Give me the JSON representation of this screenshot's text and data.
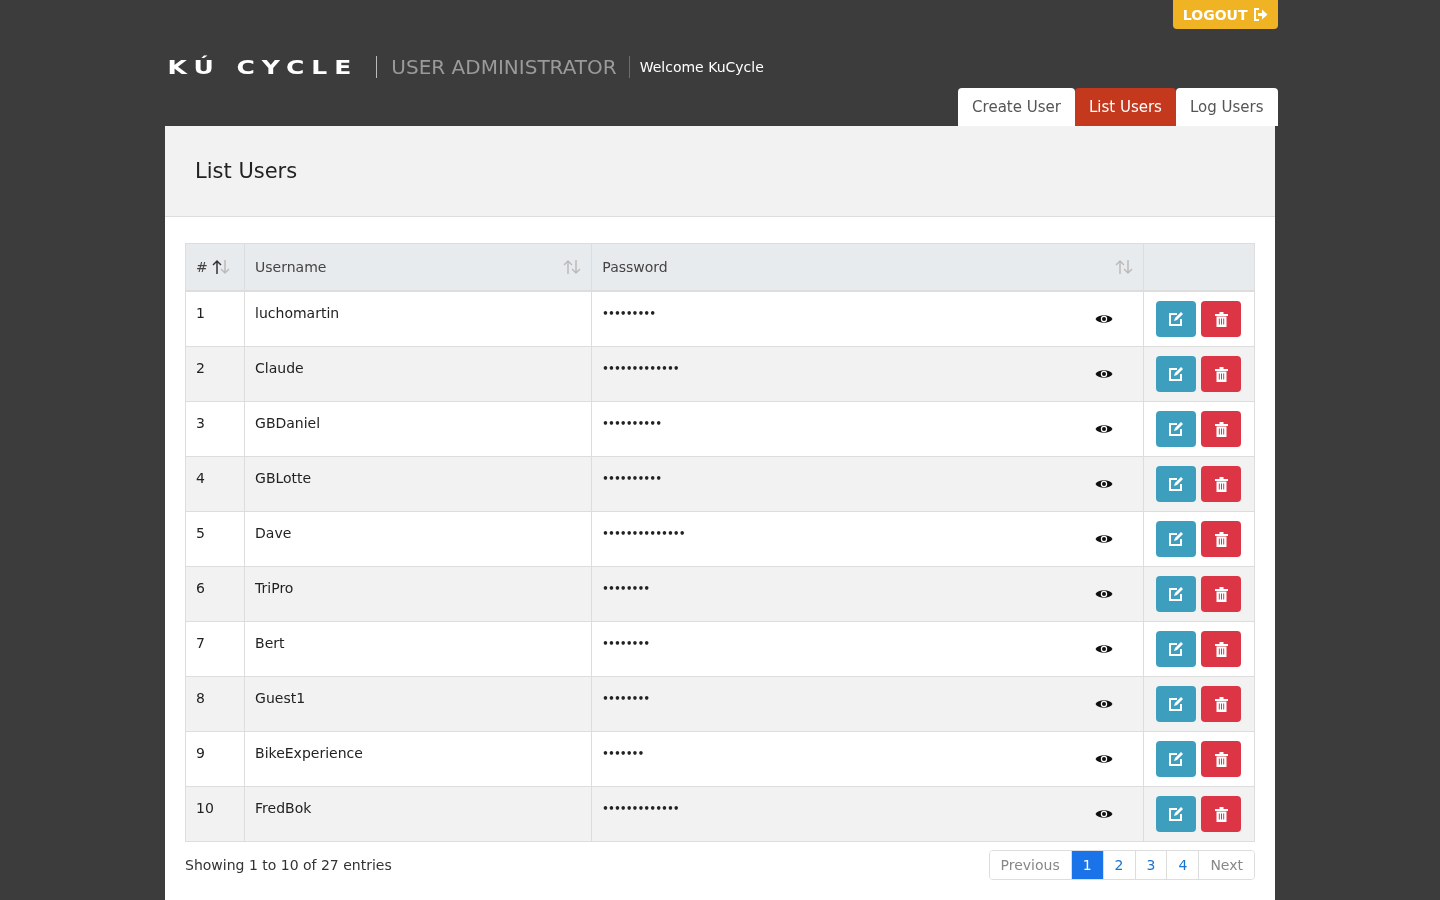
{
  "header": {
    "logout": "LOGOUT",
    "logo": "KÚ CYCLE",
    "title": "USER ADMINISTRATOR",
    "welcome": "Welcome KuCycle"
  },
  "tabs": [
    {
      "label": "Create User",
      "selected": false
    },
    {
      "label": "List Users",
      "selected": true
    },
    {
      "label": "Log Users",
      "selected": false
    }
  ],
  "panel": {
    "title": "List Users"
  },
  "table": {
    "columns": [
      {
        "label": "#",
        "sorted": true
      },
      {
        "label": "Username",
        "sorted": false
      },
      {
        "label": "Password",
        "sorted": false
      }
    ],
    "rows": [
      {
        "number": "1",
        "username": "luchomartin",
        "password": "•••••••••"
      },
      {
        "number": "2",
        "username": "Claude",
        "password": "•••••••••••••"
      },
      {
        "number": "3",
        "username": "GBDaniel",
        "password": "••••••••••"
      },
      {
        "number": "4",
        "username": "GBLotte",
        "password": "••••••••••"
      },
      {
        "number": "5",
        "username": "Dave",
        "password": "••••••••••••••"
      },
      {
        "number": "6",
        "username": "TriPro",
        "password": "••••••••"
      },
      {
        "number": "7",
        "username": "Bert",
        "password": "••••••••"
      },
      {
        "number": "8",
        "username": "Guest1",
        "password": "••••••••"
      },
      {
        "number": "9",
        "username": "BikeExperience",
        "password": "•••••••"
      },
      {
        "number": "10",
        "username": "FredBok",
        "password": "•••••••••••••"
      }
    ]
  },
  "footer": {
    "info": "Showing 1 to 10 of 27 entries",
    "pagination": [
      {
        "label": "Previous",
        "kind": "nav",
        "selected": false
      },
      {
        "label": "1",
        "kind": "page",
        "selected": true
      },
      {
        "label": "2",
        "kind": "page",
        "selected": false
      },
      {
        "label": "3",
        "kind": "page",
        "selected": false
      },
      {
        "label": "4",
        "kind": "page",
        "selected": false
      },
      {
        "label": "Next",
        "kind": "nav",
        "selected": false
      }
    ]
  }
}
